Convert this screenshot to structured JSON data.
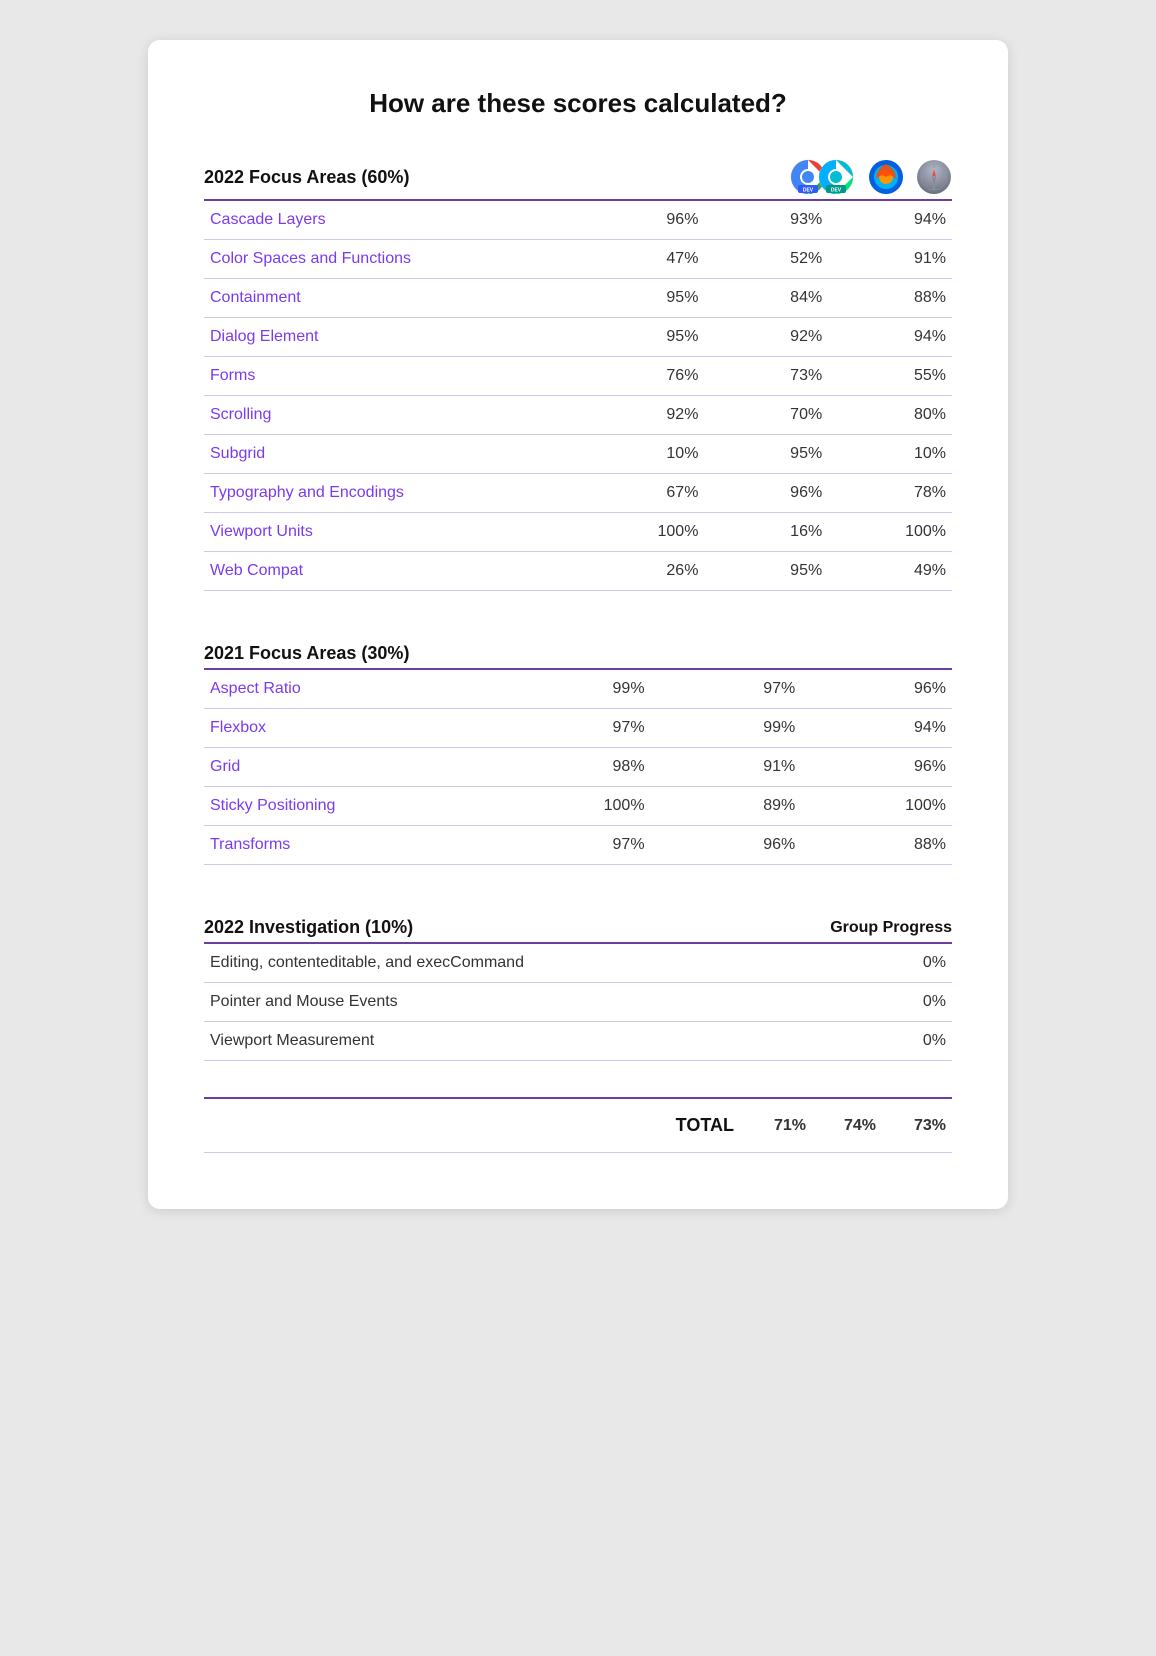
{
  "title": "How are these scores calculated?",
  "section2022": {
    "label": "2022 Focus Areas (60%)",
    "browsers": [
      "Chrome Dev",
      "Firefox",
      "Safari"
    ],
    "rows": [
      {
        "name": "Cascade Layers",
        "scores": [
          "96%",
          "93%",
          "94%"
        ]
      },
      {
        "name": "Color Spaces and Functions",
        "scores": [
          "47%",
          "52%",
          "91%"
        ]
      },
      {
        "name": "Containment",
        "scores": [
          "95%",
          "84%",
          "88%"
        ]
      },
      {
        "name": "Dialog Element",
        "scores": [
          "95%",
          "92%",
          "94%"
        ]
      },
      {
        "name": "Forms",
        "scores": [
          "76%",
          "73%",
          "55%"
        ]
      },
      {
        "name": "Scrolling",
        "scores": [
          "92%",
          "70%",
          "80%"
        ]
      },
      {
        "name": "Subgrid",
        "scores": [
          "10%",
          "95%",
          "10%"
        ]
      },
      {
        "name": "Typography and Encodings",
        "scores": [
          "67%",
          "96%",
          "78%"
        ]
      },
      {
        "name": "Viewport Units",
        "scores": [
          "100%",
          "16%",
          "100%"
        ]
      },
      {
        "name": "Web Compat",
        "scores": [
          "26%",
          "95%",
          "49%"
        ]
      }
    ]
  },
  "section2021": {
    "label": "2021 Focus Areas (30%)",
    "rows": [
      {
        "name": "Aspect Ratio",
        "scores": [
          "99%",
          "97%",
          "96%"
        ]
      },
      {
        "name": "Flexbox",
        "scores": [
          "97%",
          "99%",
          "94%"
        ]
      },
      {
        "name": "Grid",
        "scores": [
          "98%",
          "91%",
          "96%"
        ]
      },
      {
        "name": "Sticky Positioning",
        "scores": [
          "100%",
          "89%",
          "100%"
        ]
      },
      {
        "name": "Transforms",
        "scores": [
          "97%",
          "96%",
          "88%"
        ]
      }
    ]
  },
  "sectionInvestigation": {
    "label": "2022 Investigation (10%)",
    "groupProgressLabel": "Group Progress",
    "rows": [
      {
        "name": "Editing, contenteditable, and execCommand",
        "score": "0%"
      },
      {
        "name": "Pointer and Mouse Events",
        "score": "0%"
      },
      {
        "name": "Viewport Measurement",
        "score": "0%"
      }
    ]
  },
  "total": {
    "label": "TOTAL",
    "scores": [
      "71%",
      "74%",
      "73%"
    ]
  }
}
